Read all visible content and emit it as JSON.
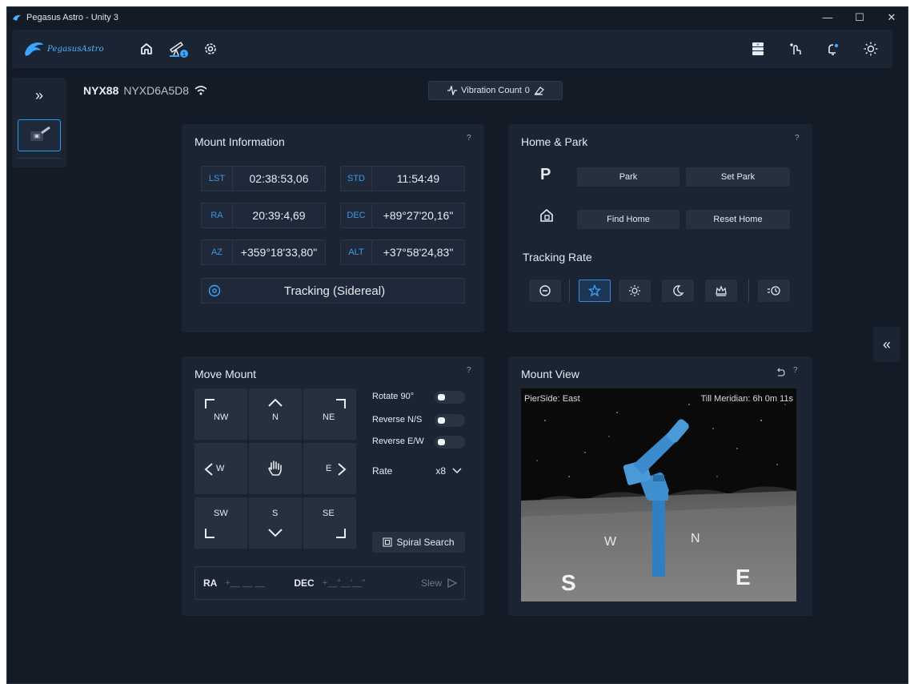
{
  "window": {
    "title": "Pegasus Astro - Unity 3",
    "minimize": "—",
    "maximize": "☐",
    "close": "✕"
  },
  "brand": {
    "logo_text": "PegasusAstro"
  },
  "device": {
    "name": "NYX88",
    "serial": "NYXD6A5D8"
  },
  "vibration": {
    "label": "Vibration Count",
    "count": "0"
  },
  "mount_info": {
    "title": "Mount Information",
    "help": "?",
    "lst_label": "LST",
    "lst_value": "02:38:53,06",
    "std_label": "STD",
    "std_value": "11:54:49",
    "ra_label": "RA",
    "ra_value": "20:39:4,69",
    "dec_label": "DEC",
    "dec_value": "+89°27'20,16\"",
    "az_label": "AZ",
    "az_value": "+359°18'33,80\"",
    "alt_label": "ALT",
    "alt_value": "+37°58'24,83\"",
    "tracking_status": "Tracking (Sidereal)"
  },
  "home_park": {
    "title": "Home & Park",
    "help": "?",
    "park_letter": "P",
    "park": "Park",
    "set_park": "Set Park",
    "find_home": "Find Home",
    "reset_home": "Reset Home",
    "tracking_rate_title": "Tracking Rate",
    "selected_rate": "sidereal",
    "rates": [
      "off",
      "sidereal",
      "solar",
      "lunar",
      "king",
      "custom"
    ]
  },
  "move_mount": {
    "title": "Move Mount",
    "help": "?",
    "nw": "NW",
    "n": "N",
    "ne": "NE",
    "w": "W",
    "e": "E",
    "sw": "SW",
    "s": "S",
    "se": "SE",
    "rotate": "Rotate 90°",
    "reverse_ns": "Reverse N/S",
    "reverse_ew": "Reverse E/W",
    "rate_label": "Rate",
    "rate_value": "x8",
    "spiral": "Spiral Search",
    "ra_label": "RA",
    "ra_placeholder": "+__ __ __",
    "dec_label": "DEC",
    "dec_placeholder": "+__°__'__\"",
    "slew": "Slew"
  },
  "mount_view": {
    "title": "Mount View",
    "help": "?",
    "pier_side": "PierSide: East",
    "till_meridian": "Till Meridian: 6h 0m 11s",
    "compass": {
      "s": "S",
      "w": "W",
      "n": "N",
      "e": "E"
    }
  },
  "colors": {
    "accent": "#2e9cf0",
    "panel": "#1b2433",
    "background": "#131b27",
    "mount_blue": "#3d8fd0"
  }
}
